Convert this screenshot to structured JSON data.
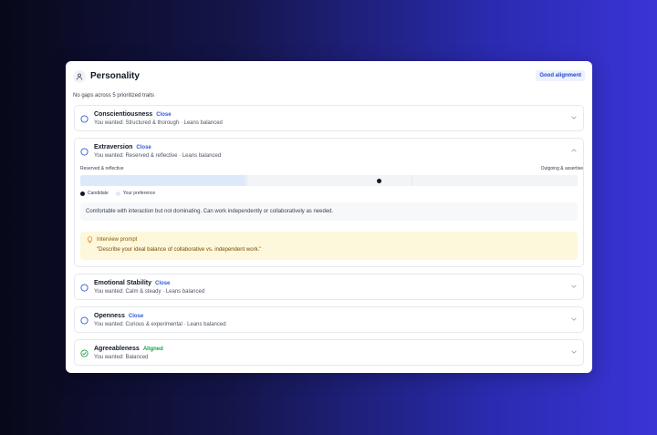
{
  "header": {
    "title": "Personality",
    "subtitle": "No gaps across 5 prioritized traits",
    "badge": "Good alignment",
    "icon": "user-icon"
  },
  "colors": {
    "accent": "#2f5bd8",
    "aligned": "#16a34a",
    "badge_bg": "#eef2ff",
    "prompt_bg": "#fdf8dc"
  },
  "traits": [
    {
      "name": "Conscientiousness",
      "status": "Close",
      "subtitle": "You wanted: Structured & thorough · Leans balanced",
      "expanded": false
    },
    {
      "name": "Extraversion",
      "status": "Close",
      "subtitle": "You wanted: Reserved & reflective · Leans balanced",
      "expanded": true,
      "scale_left": "Reserved & reflective",
      "scale_right": "Outgoing & assertive",
      "preference_range": [
        0,
        0.333
      ],
      "candidate_position": 0.6,
      "legend_candidate": "Candidate",
      "legend_preference": "Your preference",
      "description": "Comfortable with interaction but not dominating. Can work independently or collaboratively as needed.",
      "prompt_title": "Interview prompt",
      "prompt_text": "\"Describe your ideal balance of collaborative vs. independent work.\""
    },
    {
      "name": "Emotional Stability",
      "status": "Close",
      "subtitle": "You wanted: Calm & steady · Leans balanced",
      "expanded": false
    },
    {
      "name": "Openness",
      "status": "Close",
      "subtitle": "You wanted: Curious & experimental · Leans balanced",
      "expanded": false
    },
    {
      "name": "Agreeableness",
      "status": "Aligned",
      "subtitle": "You wanted: Balanced",
      "expanded": false
    }
  ]
}
